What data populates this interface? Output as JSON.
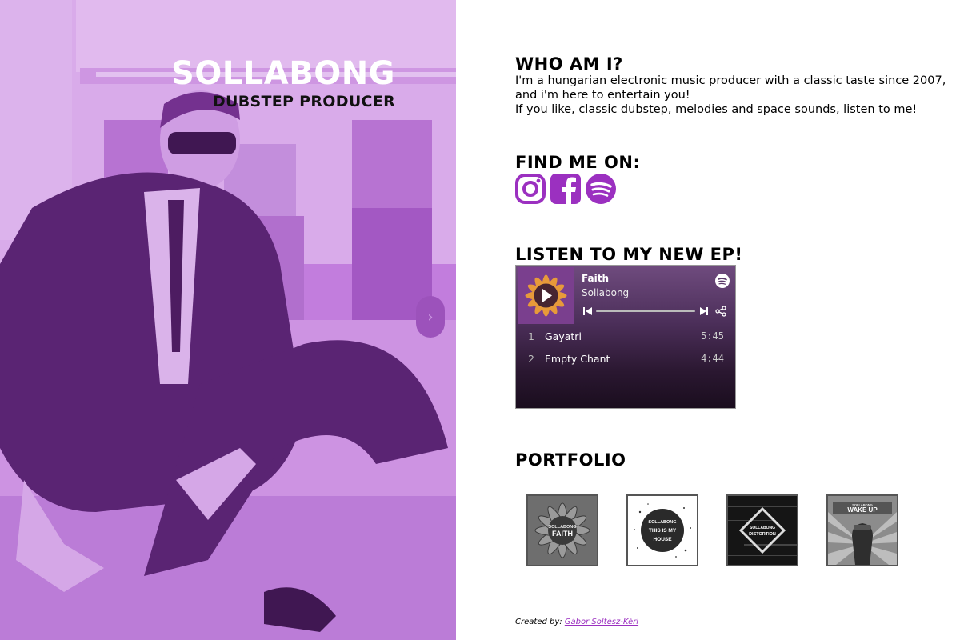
{
  "hero": {
    "name": "SOLLABONG",
    "subtitle": "DUBSTEP PRODUCER"
  },
  "who": {
    "heading": "WHO AM I?",
    "lines": [
      "I'm a hungarian electronic music producer with a classic taste since 2007,",
      "and i'm here to entertain you!",
      "If you like, classic dubstep, melodies and space sounds, listen to me!"
    ]
  },
  "find": {
    "heading": "FIND ME ON:",
    "icons": [
      "instagram-icon",
      "facebook-icon",
      "spotify-icon"
    ]
  },
  "listen": {
    "heading": "LISTEN TO MY NEW EP!",
    "player": {
      "title": "Faith",
      "artist": "Sollabong",
      "tracks": [
        {
          "num": "1",
          "name": "Gayatri",
          "duration": "5:45"
        },
        {
          "num": "2",
          "name": "Empty Chant",
          "duration": "4:44"
        }
      ]
    }
  },
  "portfolio": {
    "heading": "PORTFOLIO",
    "items": [
      {
        "lines": [
          "SOLLABONG",
          "FAITH"
        ]
      },
      {
        "lines": [
          "SOLLABONG",
          "THIS IS MY",
          "HOUSE"
        ]
      },
      {
        "lines": [
          "SOLLABONG",
          "DISTORTION"
        ]
      },
      {
        "lines": [
          "SOLLABONG",
          "WAKE UP"
        ]
      }
    ]
  },
  "footer": {
    "label": "Created by:",
    "author": "Gábor Soltész-Kéri"
  },
  "colors": {
    "accent": "#9b30c0",
    "hero_tint": "#c77fdd"
  }
}
